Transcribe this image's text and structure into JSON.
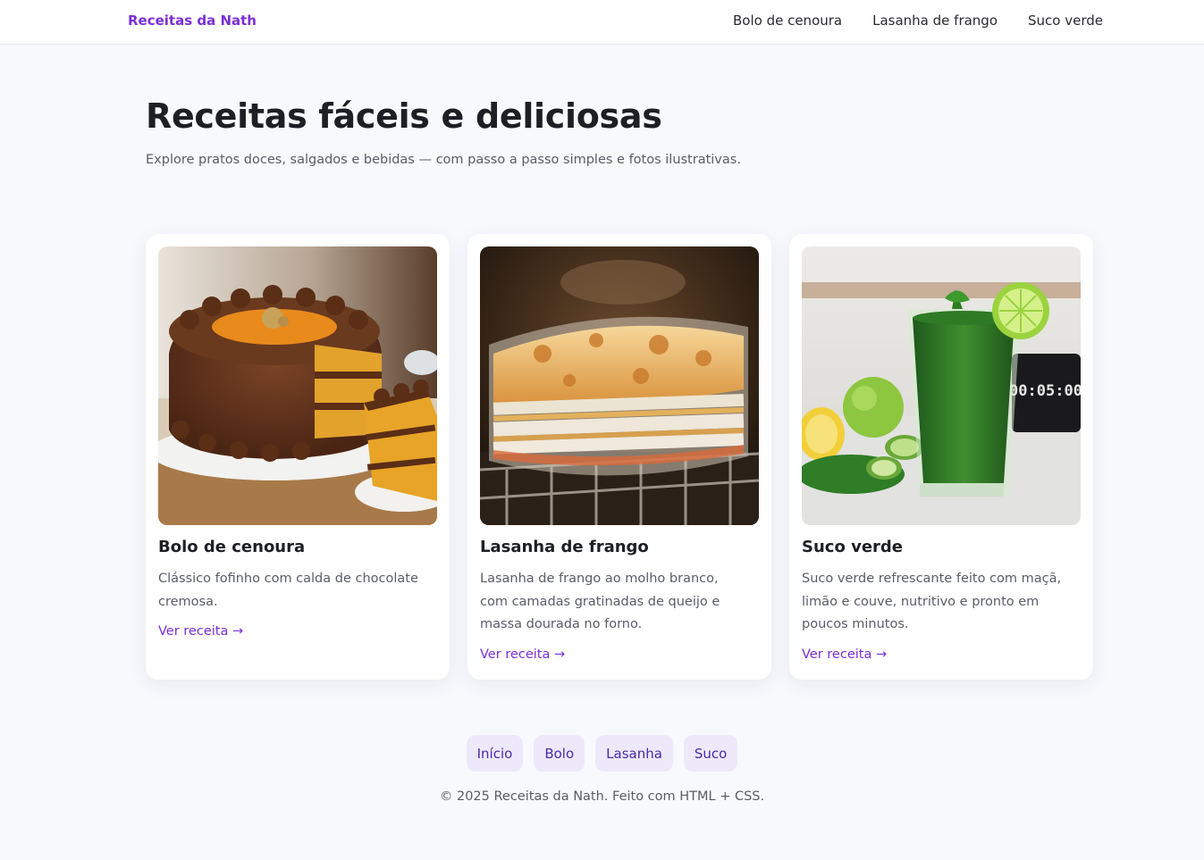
{
  "header": {
    "brand": "Receitas da Nath",
    "nav": [
      "Bolo de cenoura",
      "Lasanha de frango",
      "Suco verde"
    ]
  },
  "hero": {
    "title": "Receitas fáceis e deliciosas",
    "subtitle": "Explore pratos doces, salgados e bebidas — com passo a passo simples e fotos ilustrativas."
  },
  "cards": [
    {
      "title": "Bolo de cenoura",
      "description": "Clássico fofinho com calda de chocolate cremosa.",
      "link": "Ver receita →",
      "image": "carrot-cake-photo"
    },
    {
      "title": "Lasanha de frango",
      "description": "Lasanha de frango ao molho branco, com camadas gratinadas de queijo e massa dourada no forno.",
      "link": "Ver receita →",
      "image": "chicken-lasagna-photo"
    },
    {
      "title": "Suco verde",
      "description": "Suco verde refrescante feito com maçã, limão e couve, nutritivo e pronto em poucos minutos.",
      "link": "Ver receita →",
      "image": "green-juice-photo",
      "timer_text": "00:05:00"
    }
  ],
  "footer": {
    "pills": [
      "Início",
      "Bolo",
      "Lasanha",
      "Suco"
    ],
    "copyright": "© 2025 Receitas da Nath. Feito com HTML + CSS."
  },
  "colors": {
    "accent": "#7b2fd6",
    "background": "#f8f9fd",
    "pill_bg": "#ede9fb",
    "pill_text": "#4b2aa8"
  }
}
